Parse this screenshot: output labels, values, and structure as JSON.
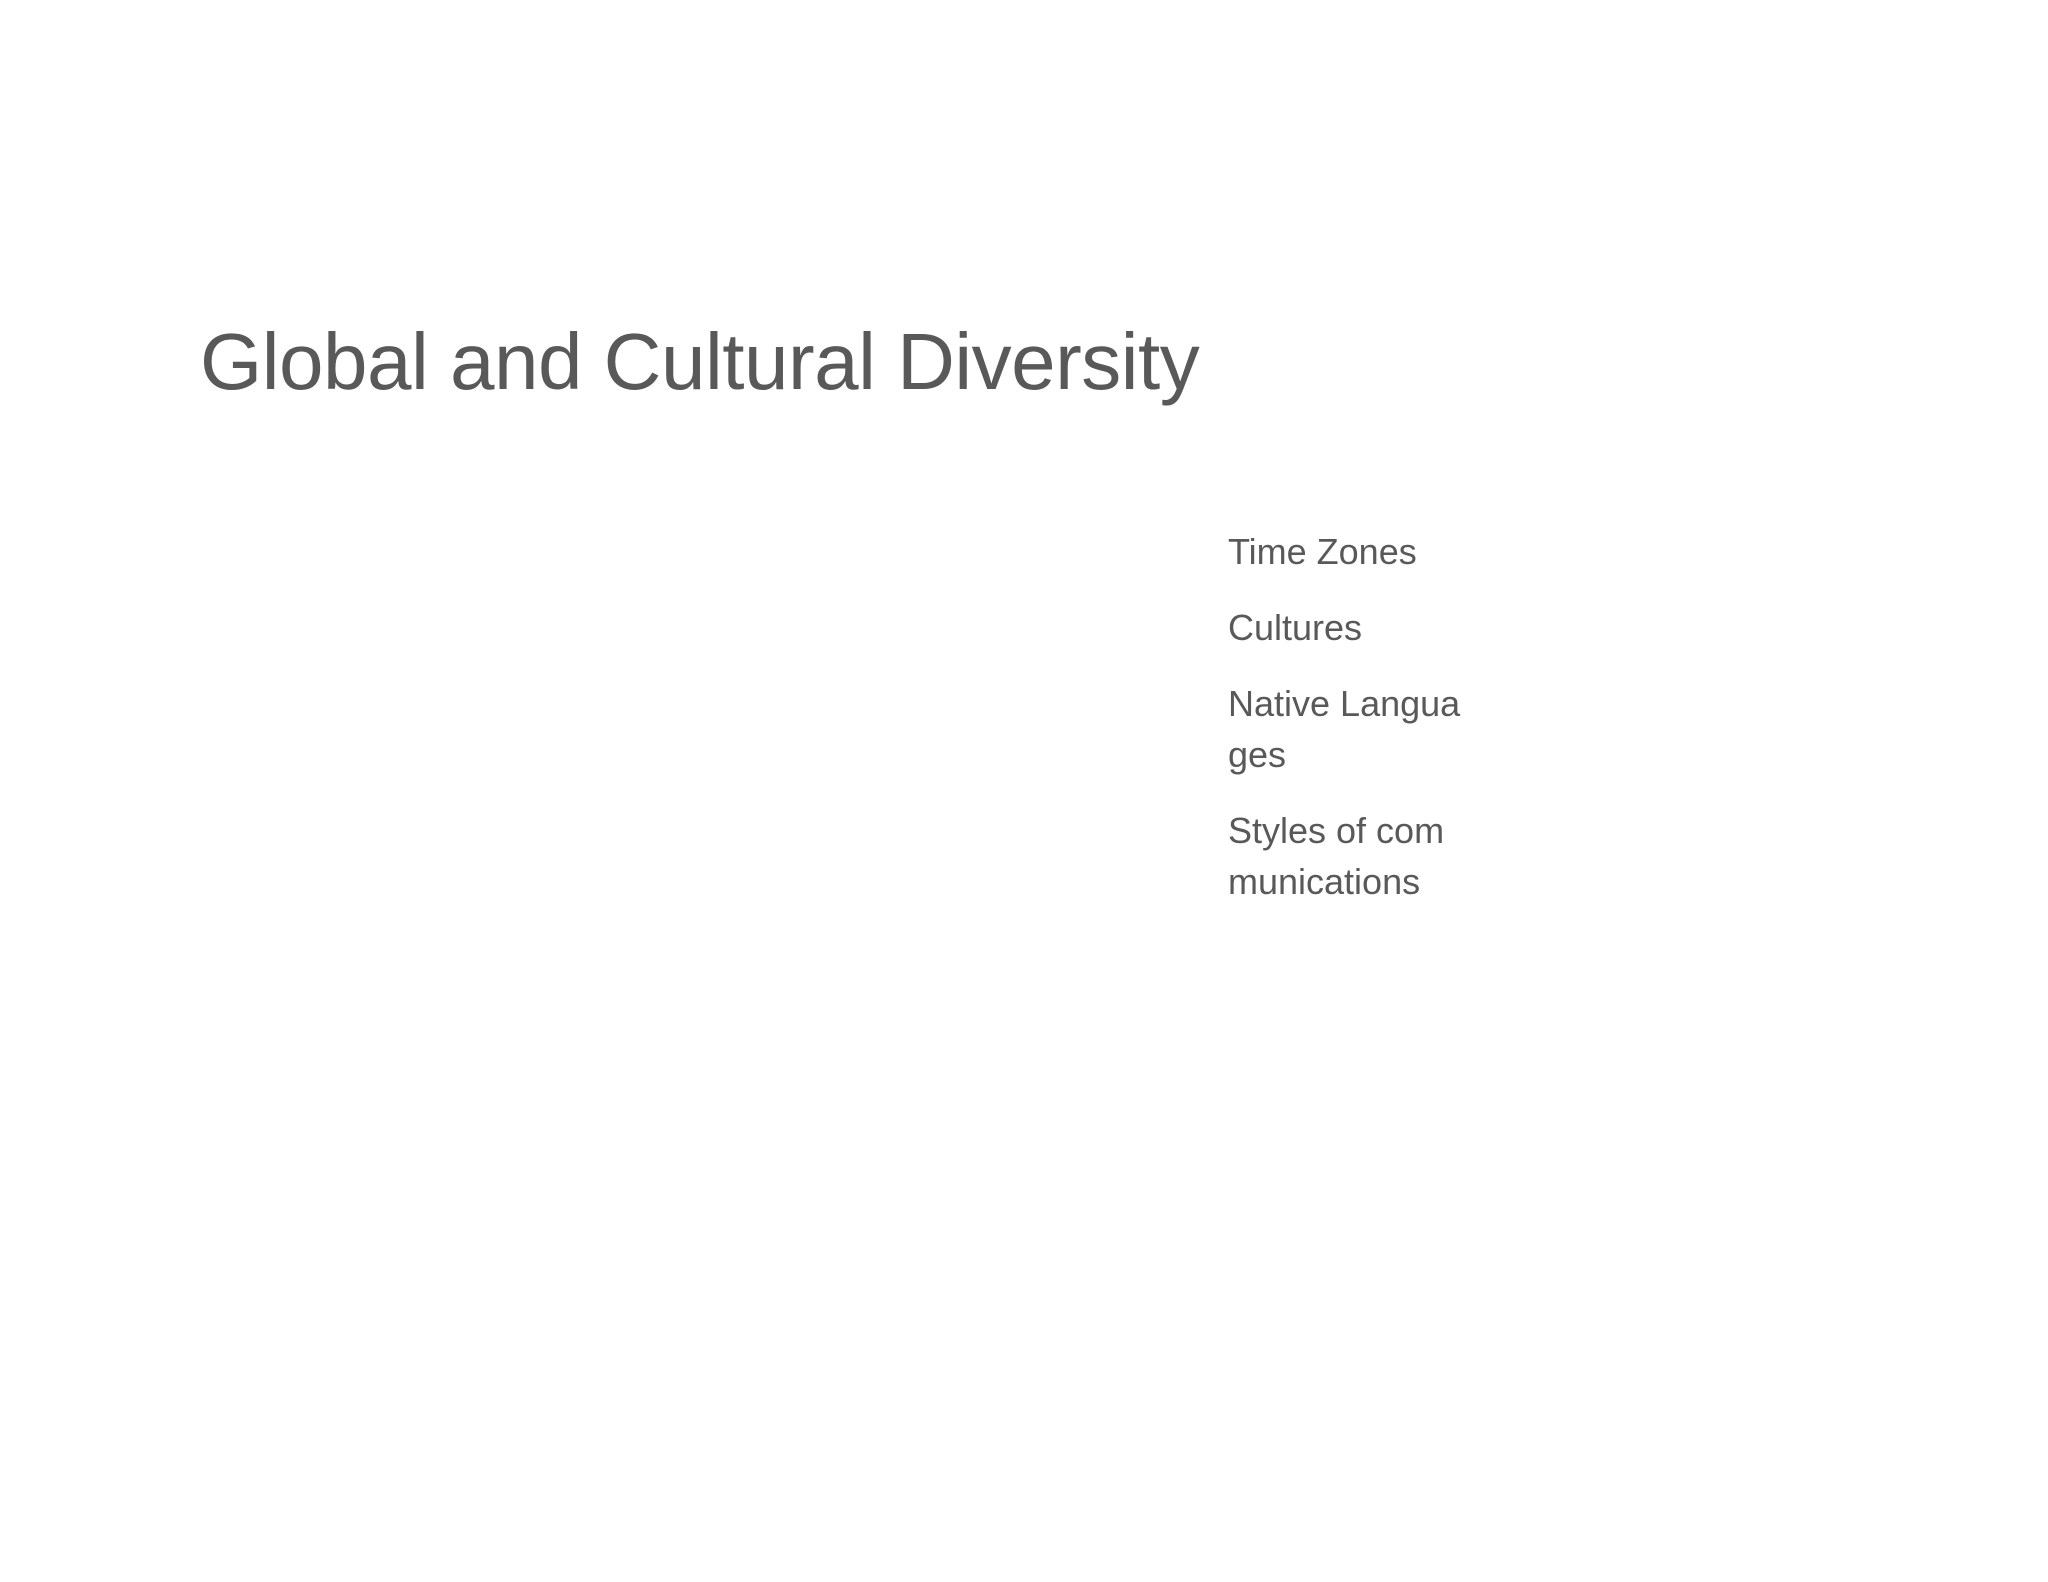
{
  "slide": {
    "title": "Global and Cultural Diversity",
    "bullets": [
      "Time Zones",
      "Cultures",
      "Native Languages",
      "Styles of communications"
    ]
  },
  "colors": {
    "background": "#ffffff",
    "text": "#595959"
  }
}
